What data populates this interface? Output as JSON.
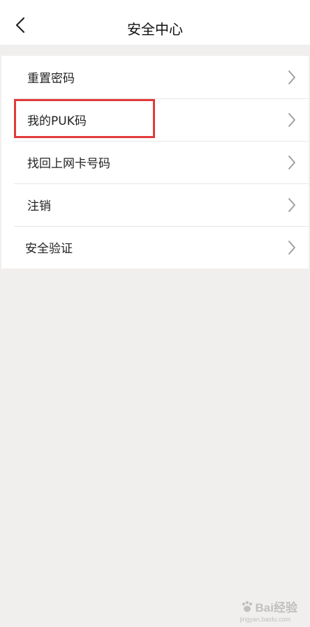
{
  "header": {
    "title": "安全中心",
    "back_icon": "chevron-left-icon"
  },
  "menu": {
    "items": [
      {
        "label": "重置密码"
      },
      {
        "label": "我的PUK码"
      },
      {
        "label": "找回上网卡号码"
      },
      {
        "label": "注销"
      },
      {
        "label": "安全验证"
      }
    ],
    "chevron_icon": "chevron-right-icon"
  },
  "annotation": {
    "highlighted_item": "我的PUK码",
    "color": "#e23a3a"
  },
  "watermark": {
    "brand": "Bai经验",
    "url": "jingyan.baidu.com"
  }
}
